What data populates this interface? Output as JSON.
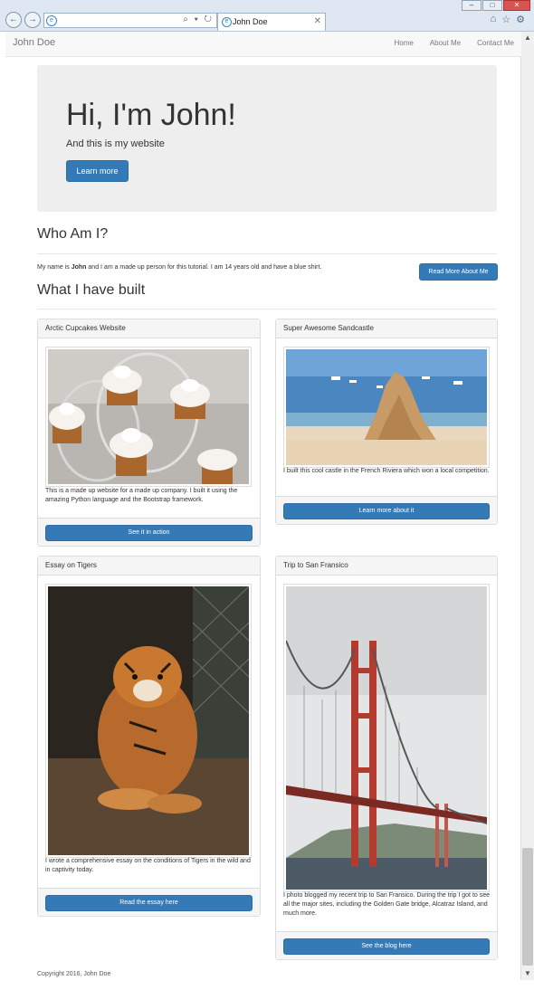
{
  "browser": {
    "tab_title": "John Doe",
    "window_buttons": [
      "–",
      "□",
      "✕"
    ],
    "nav_back": "←",
    "nav_forward": "→",
    "addr_tools": "⌕ ▾ ↻",
    "ie_glyph": "e",
    "tab_close": "✕",
    "icons": [
      "home-icon",
      "star-icon",
      "gear-icon"
    ],
    "icon_glyphs": [
      "⌂",
      "☆",
      "⚙"
    ]
  },
  "scroll": {
    "up": "▲",
    "down": "▼"
  },
  "navbar": {
    "brand": "John Doe",
    "links": [
      "Home",
      "About Me",
      "Contact Me"
    ]
  },
  "hero": {
    "title": "Hi, I'm John!",
    "subtitle": "And this is my website",
    "button": "Learn more"
  },
  "about": {
    "heading": "Who Am I?",
    "text_before": "My name is ",
    "text_name": "John",
    "text_after": " and I am a made up person for this tutorial. I am 14 years old and have a blue shirt.",
    "button": "Read More About Me"
  },
  "built": {
    "heading": "What I have built",
    "projects": [
      {
        "title": "Arctic Cupcakes Website",
        "text": "This is a made up website for a made up company. I built it using the amazing Python language and the Bootstrap framework.",
        "button": "See it in action"
      },
      {
        "title": "Super Awesome Sandcastle",
        "text": "I built this cool castle in the French Riviera which won a local competition.",
        "button": "Learn more about it"
      },
      {
        "title": "Essay on Tigers",
        "text": "I wrote a comprehensive essay on the conditions of Tigers in the wild and in captivity today.",
        "button": "Read the essay here"
      },
      {
        "title": "Trip to San Fransico",
        "text": "I photo blogged my recent trip to San Fransico. During the trip I got to see all the major sites, including the Golden Gate bridge, Alcatraz Island, and much more.",
        "button": "See the blog here"
      }
    ]
  },
  "footer": {
    "copyright": "Copyright 2016, John Doe"
  },
  "colors": {
    "primary": "#337ab7",
    "jumbotron": "#eeeeee",
    "navbar": "#f8f8f8",
    "panel_heading": "#f5f5f5"
  }
}
